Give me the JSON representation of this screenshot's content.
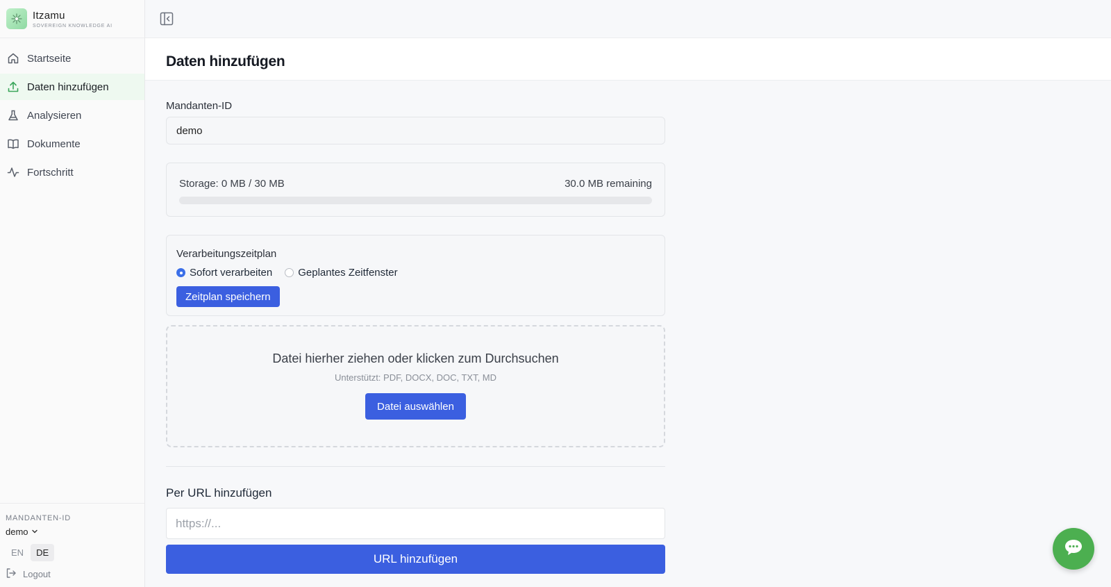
{
  "brand": {
    "name": "Itzamu",
    "tagline": "SOVEREIGN KNOWLEDGE AI"
  },
  "sidebar": {
    "items": [
      {
        "label": "Startseite",
        "icon": "home-icon",
        "active": false
      },
      {
        "label": "Daten hinzufügen",
        "icon": "upload-icon",
        "active": true
      },
      {
        "label": "Analysieren",
        "icon": "flask-icon",
        "active": false
      },
      {
        "label": "Dokumente",
        "icon": "book-icon",
        "active": false
      },
      {
        "label": "Fortschritt",
        "icon": "activity-icon",
        "active": false
      }
    ],
    "tenant_label": "MANDANTEN-ID",
    "tenant_value": "demo",
    "languages": [
      "EN",
      "DE"
    ],
    "active_language": "DE",
    "logout_label": "Logout"
  },
  "page": {
    "title": "Daten hinzufügen"
  },
  "tenant_field": {
    "label": "Mandanten-ID",
    "value": "demo"
  },
  "storage": {
    "used_text": "Storage: 0 MB / 30 MB",
    "remaining_text": "30.0 MB remaining",
    "used_fraction": 0
  },
  "schedule": {
    "title": "Verarbeitungszeitplan",
    "options": [
      "Sofort verarbeiten",
      "Geplantes Zeitfenster"
    ],
    "selected": "Sofort verarbeiten",
    "save_label": "Zeitplan speichern"
  },
  "dropzone": {
    "title": "Datei hierher ziehen oder klicken zum Durchsuchen",
    "supported": "Unterstützt: PDF, DOCX, DOC, TXT, MD",
    "button_label": "Datei auswählen"
  },
  "url_section": {
    "label": "Per URL hinzufügen",
    "placeholder": "https://...",
    "value": "",
    "button_label": "URL hinzufügen"
  },
  "colors": {
    "primary": "#3b5fe0",
    "accent_green": "#4caf50",
    "active_nav_bg": "#eef9f0"
  }
}
